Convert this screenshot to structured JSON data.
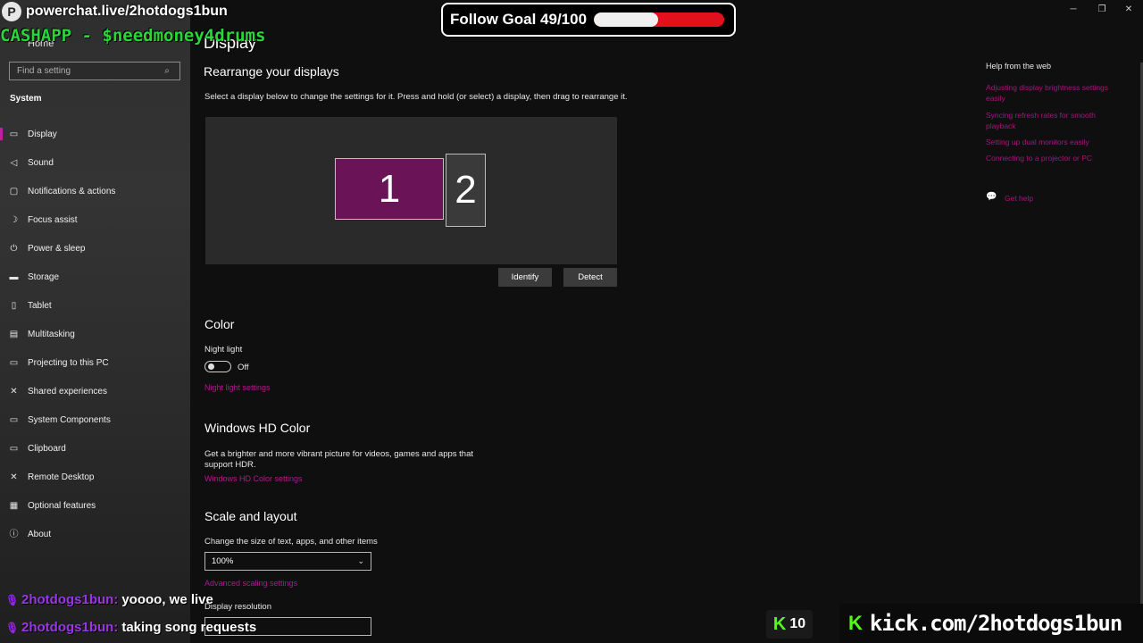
{
  "sidebar": {
    "home_label": "Home",
    "search_placeholder": "Find a setting",
    "section_title": "System",
    "items": [
      {
        "label": "Display",
        "icon": "monitor-icon",
        "glyph": "▭"
      },
      {
        "label": "Sound",
        "icon": "speaker-icon",
        "glyph": "◁"
      },
      {
        "label": "Notifications & actions",
        "icon": "notification-icon",
        "glyph": "▢"
      },
      {
        "label": "Focus assist",
        "icon": "moon-icon",
        "glyph": "☽"
      },
      {
        "label": "Power & sleep",
        "icon": "power-icon",
        "glyph": "⏻"
      },
      {
        "label": "Storage",
        "icon": "storage-icon",
        "glyph": "▬"
      },
      {
        "label": "Tablet",
        "icon": "tablet-icon",
        "glyph": "▯"
      },
      {
        "label": "Multitasking",
        "icon": "multitasking-icon",
        "glyph": "▤"
      },
      {
        "label": "Projecting to this PC",
        "icon": "projector-icon",
        "glyph": "▭"
      },
      {
        "label": "Shared experiences",
        "icon": "shared-icon",
        "glyph": "✕"
      },
      {
        "label": "System Components",
        "icon": "components-icon",
        "glyph": "▭"
      },
      {
        "label": "Clipboard",
        "icon": "clipboard-icon",
        "glyph": "▭"
      },
      {
        "label": "Remote Desktop",
        "icon": "remote-icon",
        "glyph": "✕"
      },
      {
        "label": "Optional features",
        "icon": "features-icon",
        "glyph": "▦"
      },
      {
        "label": "About",
        "icon": "info-icon",
        "glyph": "ⓘ"
      }
    ]
  },
  "main": {
    "page_title": "Display",
    "rearrange_title": "Rearrange your displays",
    "rearrange_desc": "Select a display below to change the settings for it. Press and hold (or select) a display, then drag to rearrange it.",
    "monitor1": "1",
    "monitor2": "2",
    "identify_label": "Identify",
    "detect_label": "Detect",
    "color_title": "Color",
    "night_light_label": "Night light",
    "night_light_state": "Off",
    "night_light_link": "Night light settings",
    "hdr_title": "Windows HD Color",
    "hdr_desc_1": "Get a brighter and more vibrant picture for videos, games and apps that",
    "hdr_desc_2": "support HDR.",
    "hdr_link": "Windows HD Color settings",
    "scale_title": "Scale and layout",
    "scale_label": "Change the size of text, apps, and other items",
    "scale_value": "100%",
    "advanced_scaling_link": "Advanced scaling settings",
    "resolution_label": "Display resolution"
  },
  "help": {
    "title": "Help from the web",
    "links": [
      {
        "line1": "Adjusting display brightness settings",
        "line2": "easily"
      },
      {
        "line1": "Syncing refresh rates for smooth",
        "line2": "playback"
      },
      {
        "line1": "Setting up dual monitors easily",
        "line2": ""
      },
      {
        "line1": "Connecting to a projector or PC",
        "line2": ""
      }
    ],
    "get_help": "Get help"
  },
  "overlay": {
    "powerchat": "powerchat.live/2hotdogs1bun",
    "cashapp": "CASHAPP - $needmoney4drums",
    "follow_goal": "Follow Goal 49/100",
    "follow_current": 49,
    "follow_target": 100,
    "chat": [
      {
        "user": "2hotdogs1bun:",
        "msg": "yoooo, we live"
      },
      {
        "user": "2hotdogs1bun:",
        "msg": "taking song requests"
      }
    ],
    "kick_viewers": "10",
    "kick_url": "kick.com/2hotdogs1bun"
  },
  "colors": {
    "accent": "#b3178f",
    "selected_monitor": "#6b1357",
    "kick_green": "#53fc18",
    "goal_red": "#e0101c"
  }
}
